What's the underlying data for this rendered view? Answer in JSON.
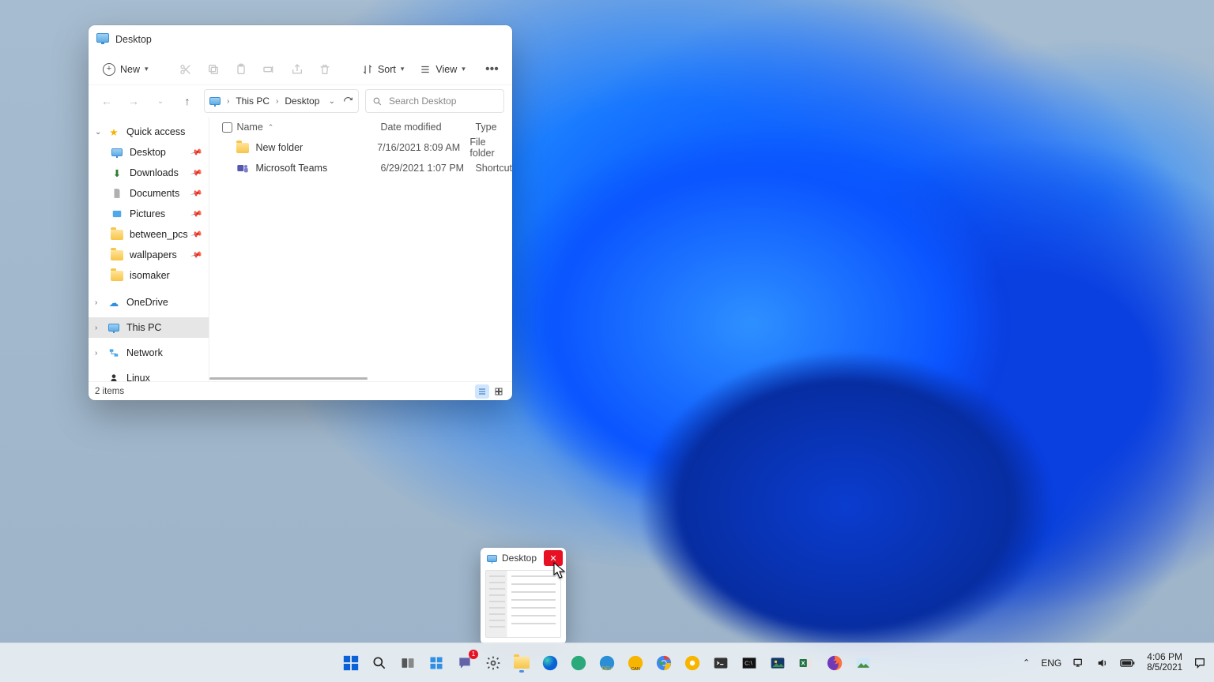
{
  "window": {
    "title": "Desktop"
  },
  "toolbar": {
    "new_label": "New",
    "sort_label": "Sort",
    "view_label": "View"
  },
  "breadcrumb": {
    "root": "This PC",
    "current": "Desktop"
  },
  "search": {
    "placeholder": "Search Desktop"
  },
  "sidebar": {
    "quick_access": "Quick access",
    "pinned": [
      {
        "label": "Desktop"
      },
      {
        "label": "Downloads"
      },
      {
        "label": "Documents"
      },
      {
        "label": "Pictures"
      },
      {
        "label": "between_pcs"
      },
      {
        "label": "wallpapers"
      }
    ],
    "isomaker": "isomaker",
    "onedrive": "OneDrive",
    "this_pc": "This PC",
    "network": "Network",
    "linux": "Linux"
  },
  "columns": {
    "name": "Name",
    "date": "Date modified",
    "type": "Type"
  },
  "files": [
    {
      "name": "New folder",
      "date": "7/16/2021 8:09 AM",
      "type": "File folder"
    },
    {
      "name": "Microsoft Teams",
      "date": "6/29/2021 1:07 PM",
      "type": "Shortcut"
    }
  ],
  "status": {
    "item_count": "2 items"
  },
  "preview": {
    "title": "Desktop"
  },
  "tray": {
    "lang": "ENG",
    "time": "4:06 PM",
    "date": "8/5/2021"
  },
  "chat_badge": "1"
}
